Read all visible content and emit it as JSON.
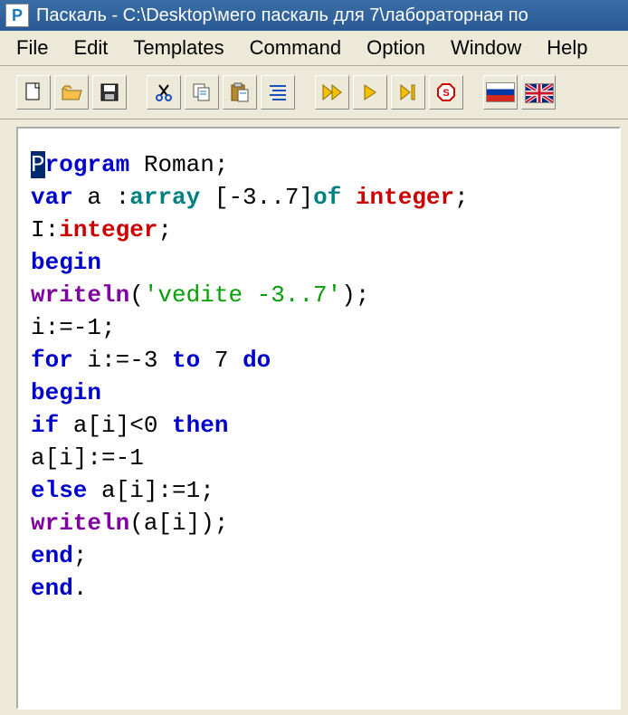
{
  "titlebar": {
    "title": "Паскаль - C:\\Desktop\\мего паскаль для 7\\лабораторная по"
  },
  "menubar": {
    "items": [
      "File",
      "Edit",
      "Templates",
      "Command",
      "Option",
      "Window",
      "Help"
    ]
  },
  "toolbar": {
    "buttons": [
      {
        "name": "new-icon"
      },
      {
        "name": "open-icon"
      },
      {
        "name": "save-icon"
      },
      {
        "name": "sep"
      },
      {
        "name": "cut-icon"
      },
      {
        "name": "copy-icon"
      },
      {
        "name": "paste-icon"
      },
      {
        "name": "format-icon"
      },
      {
        "name": "sep"
      },
      {
        "name": "run-fast-icon"
      },
      {
        "name": "run-icon"
      },
      {
        "name": "step-icon"
      },
      {
        "name": "stop-icon"
      },
      {
        "name": "sep"
      },
      {
        "name": "flag-ru-icon"
      },
      {
        "name": "flag-uk-icon"
      }
    ]
  },
  "code": {
    "lines": [
      [
        {
          "t": "P",
          "c": "kw-cursor"
        },
        {
          "t": "rogram",
          "c": "kw-blue"
        },
        {
          "t": " Roman;",
          "c": "kw-dark"
        }
      ],
      [
        {
          "t": "var",
          "c": "kw-blue"
        },
        {
          "t": " a :",
          "c": "kw-dark"
        },
        {
          "t": "array",
          "c": "kw-teal"
        },
        {
          "t": " [-3..7]",
          "c": "kw-dark"
        },
        {
          "t": "of",
          "c": "kw-teal"
        },
        {
          "t": " ",
          "c": "kw-dark"
        },
        {
          "t": "integer",
          "c": "kw-red"
        },
        {
          "t": ";",
          "c": "kw-dark"
        }
      ],
      [
        {
          "t": "I:",
          "c": "kw-dark"
        },
        {
          "t": "integer",
          "c": "kw-red"
        },
        {
          "t": ";",
          "c": "kw-dark"
        }
      ],
      [
        {
          "t": "begin",
          "c": "kw-blue"
        }
      ],
      [
        {
          "t": "writeln",
          "c": "kw-fn"
        },
        {
          "t": "(",
          "c": "kw-dark"
        },
        {
          "t": "'vedite -3..7'",
          "c": "kw-str"
        },
        {
          "t": ");",
          "c": "kw-dark"
        }
      ],
      [
        {
          "t": "i:=-1;",
          "c": "kw-dark"
        }
      ],
      [
        {
          "t": "for",
          "c": "kw-blue"
        },
        {
          "t": " i:=-3 ",
          "c": "kw-dark"
        },
        {
          "t": "to",
          "c": "kw-blue"
        },
        {
          "t": " 7 ",
          "c": "kw-dark"
        },
        {
          "t": "do",
          "c": "kw-blue"
        }
      ],
      [
        {
          "t": "begin",
          "c": "kw-blue"
        }
      ],
      [
        {
          "t": "if",
          "c": "kw-blue"
        },
        {
          "t": " a[i]<0 ",
          "c": "kw-dark"
        },
        {
          "t": "then",
          "c": "kw-blue"
        }
      ],
      [
        {
          "t": "a[i]:=-1",
          "c": "kw-dark"
        }
      ],
      [
        {
          "t": "else",
          "c": "kw-blue"
        },
        {
          "t": " a[i]:=1;",
          "c": "kw-dark"
        }
      ],
      [
        {
          "t": "writeln",
          "c": "kw-fn"
        },
        {
          "t": "(a[i]);",
          "c": "kw-dark"
        }
      ],
      [
        {
          "t": "end",
          "c": "kw-blue"
        },
        {
          "t": ";",
          "c": "kw-dark"
        }
      ],
      [
        {
          "t": "end",
          "c": "kw-blue"
        },
        {
          "t": ".",
          "c": "kw-dark"
        }
      ]
    ]
  }
}
